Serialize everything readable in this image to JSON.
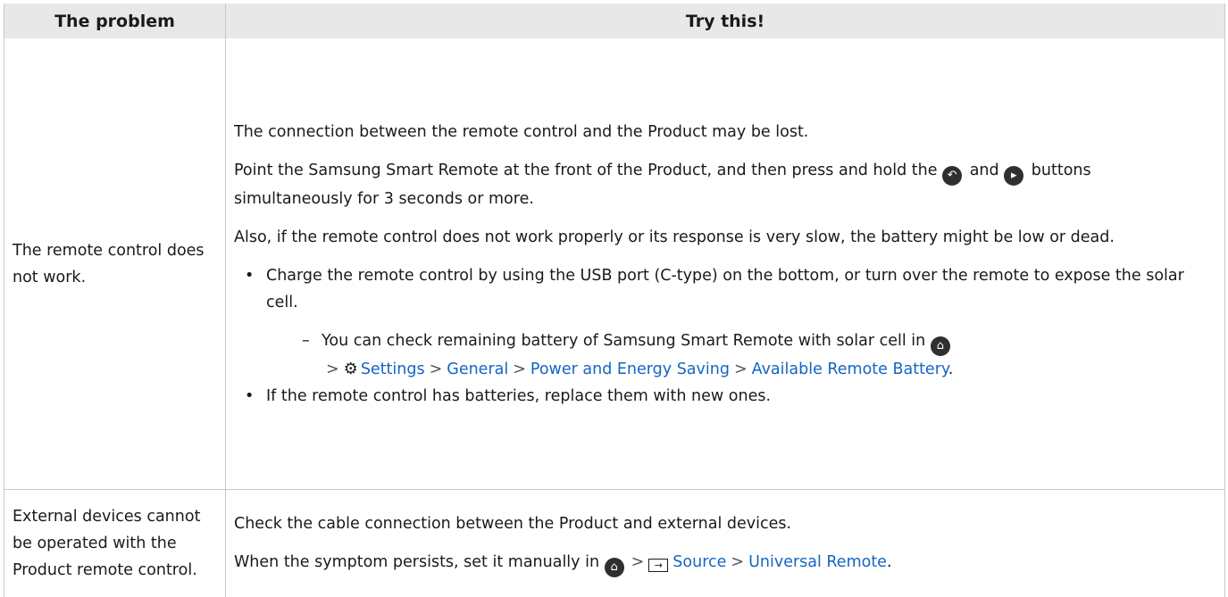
{
  "header": {
    "col1": "The problem",
    "col2": "Try this!"
  },
  "rows": [
    {
      "problem": "The remote control does not work.",
      "p1": "The connection between the remote control and the Product may be lost.",
      "p2a": "Point the Samsung Smart Remote at the front of the Product, and then press and hold the",
      "p2and": "and",
      "p2b": "buttons simultaneously for 3 seconds or more.",
      "p3": "Also, if the remote control does not work properly or its response is very slow, the battery might be low or dead.",
      "bullet1": "Charge the remote control by using the USB port (C-type) on the bottom, or turn over the remote to expose the solar cell.",
      "sub1_text": "You can check remaining battery of Samsung Smart Remote with solar cell in",
      "sub1_path": [
        "Settings",
        "General",
        "Power and Energy Saving",
        "Available Remote Battery"
      ],
      "bullet2": "If the remote control has batteries, replace them with new ones."
    },
    {
      "problem": "External devices cannot be operated with the Product remote control.",
      "p1": "Check the cable connection between the Product and external devices.",
      "p2": "When the symptom persists, set it manually in",
      "path": [
        "Source",
        "Universal Remote"
      ]
    }
  ],
  "icons": [
    "back-button-icon",
    "play-pause-button-icon",
    "home-icon",
    "settings-gear-icon",
    "source-icon"
  ],
  "colors": {
    "header_bg": "#e8e8e8",
    "link": "#1565c0",
    "border": "#c8c8c8"
  }
}
